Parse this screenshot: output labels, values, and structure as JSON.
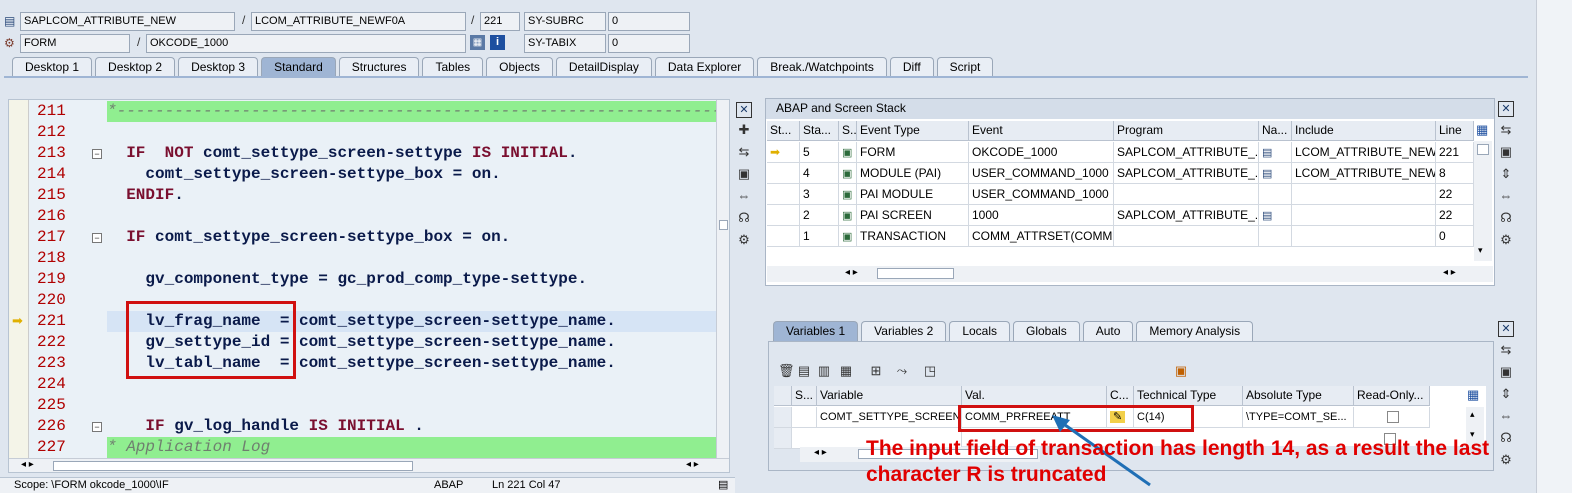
{
  "header": {
    "program": "SAPLCOM_ATTRIBUTE_NEW",
    "include": "LCOM_ATTRIBUTE_NEWF0A",
    "line": "221",
    "sysubrc_label": "SY-SUBRC",
    "sysubrc_val": "0",
    "type": "FORM",
    "name": "OKCODE_1000",
    "sytabix_label": "SY-TABIX",
    "sytabix_val": "0"
  },
  "tabs": [
    "Desktop 1",
    "Desktop 2",
    "Desktop 3",
    "Standard",
    "Structures",
    "Tables",
    "Objects",
    "DetailDisplay",
    "Data Explorer",
    "Break./Watchpoints",
    "Diff",
    "Script"
  ],
  "active_tab": "Standard",
  "editor": {
    "lines": [
      {
        "n": "211",
        "code": "*------------------------------------------------------------------"
      },
      {
        "n": "212",
        "code": ""
      },
      {
        "n": "213",
        "code": "  IF  NOT comt_settype_screen-settype IS INITIAL."
      },
      {
        "n": "214",
        "code": "    comt_settype_screen-settype_box = on."
      },
      {
        "n": "215",
        "code": "  ENDIF."
      },
      {
        "n": "216",
        "code": ""
      },
      {
        "n": "217",
        "code": "  IF comt_settype_screen-settype_box = on."
      },
      {
        "n": "218",
        "code": ""
      },
      {
        "n": "219",
        "code": "    gv_component_type = gc_prod_comp_type-settype."
      },
      {
        "n": "220",
        "code": ""
      },
      {
        "n": "221",
        "code": "    lv_frag_name  = comt_settype_screen-settype_name."
      },
      {
        "n": "222",
        "code": "    gv_settype_id = comt_settype_screen-settype_name."
      },
      {
        "n": "223",
        "code": "    lv_tabl_name  = comt_settype_screen-settype_name."
      },
      {
        "n": "224",
        "code": ""
      },
      {
        "n": "225",
        "code": ""
      },
      {
        "n": "226",
        "code": "    IF gv_log_handle IS INITIAL ."
      },
      {
        "n": "227",
        "code": "* Application Log"
      }
    ]
  },
  "status": {
    "scope": "Scope: \\FORM okcode_1000\\IF",
    "lang": "ABAP",
    "pos": "Ln 221 Col  47"
  },
  "stack": {
    "title": "ABAP and Screen Stack",
    "columns": [
      "St...",
      "Sta...",
      "S...",
      "Event Type",
      "Event",
      "Program",
      "Na...",
      "Include",
      "Line"
    ],
    "rows": [
      {
        "sta": "5",
        "type": "FORM",
        "event": "OKCODE_1000",
        "program": "SAPLCOM_ATTRIBUTE_...",
        "include": "LCOM_ATTRIBUTE_NEW...",
        "line": "221"
      },
      {
        "sta": "4",
        "type": "MODULE (PAI)",
        "event": "USER_COMMAND_1000",
        "program": "SAPLCOM_ATTRIBUTE_...",
        "include": "LCOM_ATTRIBUTE_NEW...",
        "line": "8"
      },
      {
        "sta": "3",
        "type": "PAI MODULE",
        "event": "USER_COMMAND_1000",
        "program": "",
        "include": "",
        "line": "22"
      },
      {
        "sta": "2",
        "type": "PAI SCREEN",
        "event": "1000",
        "program": "SAPLCOM_ATTRIBUTE_...",
        "include": "",
        "line": "22"
      },
      {
        "sta": "1",
        "type": "TRANSACTION",
        "event": "COMM_ATTRSET(COMM...",
        "program": "",
        "include": "",
        "line": "0"
      }
    ]
  },
  "vartabs": [
    "Variables 1",
    "Variables 2",
    "Locals",
    "Globals",
    "Auto",
    "Memory Analysis"
  ],
  "vars": {
    "columns": [
      "S...",
      "Variable",
      "Val.",
      "C...",
      "Technical Type",
      "Absolute Type",
      "Read-Only..."
    ],
    "rows": [
      {
        "variable": "COMT_SETTYPE_SCREEN...",
        "val": "COMM_PRFREEATT",
        "ttype": "C(14)",
        "atype": "\\TYPE=COMT_SE..."
      }
    ]
  },
  "annotation": {
    "line1": "The input field of transaction has length 14, as a result the last",
    "line2": "character R is truncated"
  }
}
